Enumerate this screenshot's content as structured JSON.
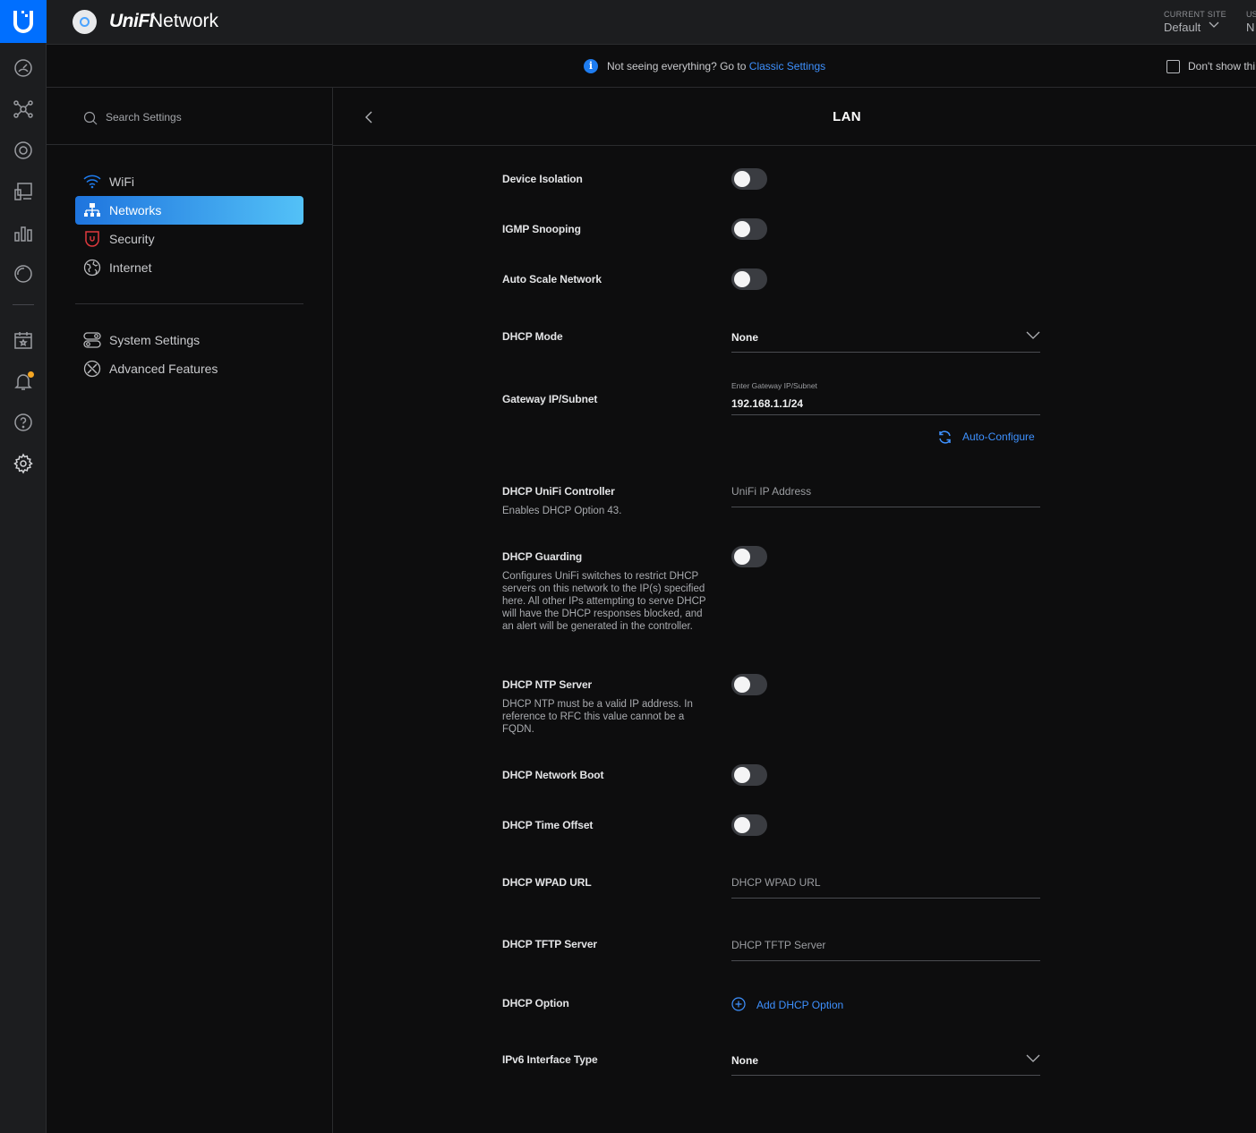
{
  "topbar": {
    "brand_unifi": "UniFi",
    "brand_network": "Network",
    "site_label": "CURRENT SITE",
    "site_value": "Default",
    "user_label": "US",
    "user_value": "N"
  },
  "notice": {
    "text": "Not seeing everything? Go to",
    "link": "Classic Settings",
    "dont_show": "Don't show thi"
  },
  "sidebar": {
    "search_placeholder": "Search Settings",
    "items": [
      {
        "label": "WiFi",
        "icon": "wifi-icon",
        "active": false
      },
      {
        "label": "Networks",
        "icon": "network-icon",
        "active": true
      },
      {
        "label": "Security",
        "icon": "shield-icon",
        "active": false
      },
      {
        "label": "Internet",
        "icon": "globe-icon",
        "active": false
      }
    ],
    "items2": [
      {
        "label": "System Settings",
        "icon": "system-settings-icon"
      },
      {
        "label": "Advanced Features",
        "icon": "advanced-features-icon"
      }
    ]
  },
  "main": {
    "title": "LAN",
    "device_isolation": "Device Isolation",
    "igmp_snooping": "IGMP Snooping",
    "auto_scale": "Auto Scale Network",
    "dhcp_mode": {
      "label": "DHCP Mode",
      "value": "None"
    },
    "gateway": {
      "label": "Gateway IP/Subnet",
      "field_label": "Enter Gateway IP/Subnet",
      "value": "192.168.1.1/24",
      "auto_configure": "Auto-Configure"
    },
    "dhcp_controller": {
      "label": "DHCP UniFi Controller",
      "desc": "Enables DHCP Option 43.",
      "placeholder": "UniFi IP Address"
    },
    "dhcp_guarding": {
      "label": "DHCP Guarding",
      "desc": "Configures UniFi switches to restrict DHCP servers on this network to the IP(s) specified here. All other IPs attempting to serve DHCP will have the DHCP responses blocked, and an alert will be generated in the controller."
    },
    "dhcp_ntp": {
      "label": "DHCP NTP Server",
      "desc": "DHCP NTP must be a valid IP address. In reference to RFC this value cannot be a FQDN."
    },
    "dhcp_network_boot": "DHCP Network Boot",
    "dhcp_time_offset": "DHCP Time Offset",
    "dhcp_wpad": {
      "label": "DHCP WPAD URL",
      "placeholder": "DHCP WPAD URL"
    },
    "dhcp_tftp": {
      "label": "DHCP TFTP Server",
      "placeholder": "DHCP TFTP Server"
    },
    "dhcp_option": {
      "label": "DHCP Option",
      "add": "Add DHCP Option"
    },
    "ipv6": {
      "label": "IPv6 Interface Type",
      "value": "None"
    }
  },
  "colors": {
    "accent": "#006fff",
    "link": "#3e91ff",
    "background": "#0d0d0e"
  }
}
